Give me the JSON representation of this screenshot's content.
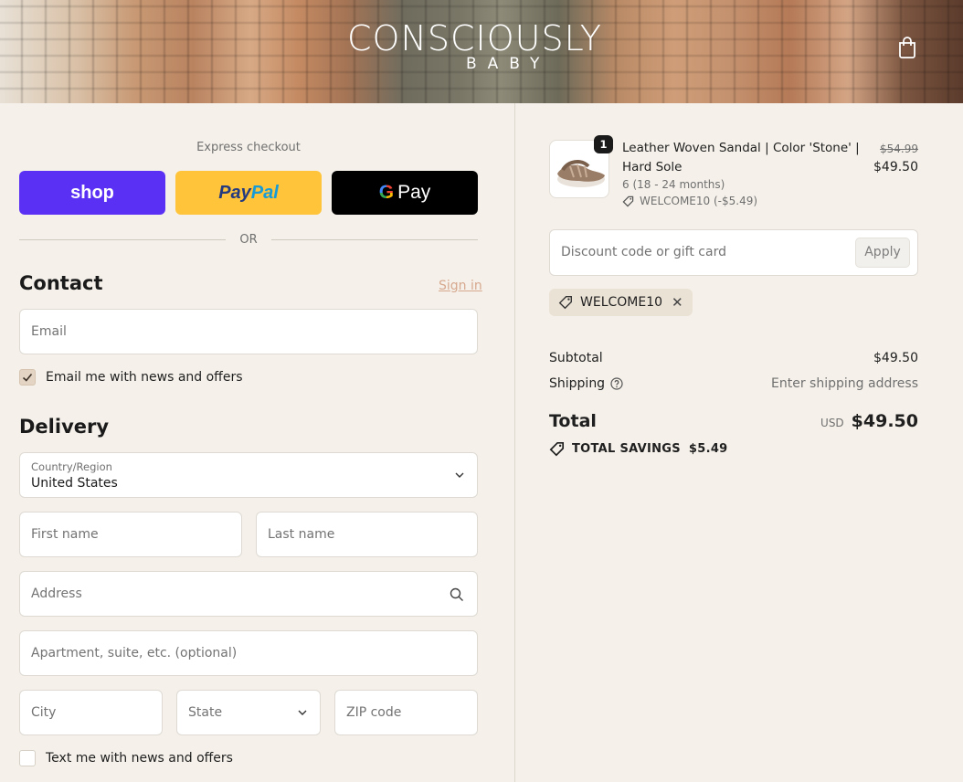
{
  "header": {
    "logo_main": "CONSCIOUSLY",
    "logo_sub": "BABY",
    "cart_icon": "shopping-bag-icon"
  },
  "express": {
    "title": "Express checkout",
    "shop_label": "shop",
    "paypal_a": "Pay",
    "paypal_b": "Pal",
    "gpay_g": "G",
    "gpay_label": "Pay",
    "or_label": "OR"
  },
  "contact": {
    "title": "Contact",
    "signin_label": "Sign in",
    "email_placeholder": "Email",
    "news_label": "Email me with news and offers",
    "news_checked": true
  },
  "delivery": {
    "title": "Delivery",
    "country_label": "Country/Region",
    "country_value": "United States",
    "first_name_placeholder": "First name",
    "last_name_placeholder": "Last name",
    "address_placeholder": "Address",
    "apartment_placeholder": "Apartment, suite, etc. (optional)",
    "city_placeholder": "City",
    "state_placeholder": "State",
    "zip_placeholder": "ZIP code",
    "text_label": "Text me with news and offers",
    "text_checked": false
  },
  "order": {
    "item": {
      "quantity": "1",
      "name": "Leather Woven Sandal | Color 'Stone' | Hard Sole",
      "variant": "6 (18 - 24 months)",
      "discount": "WELCOME10 (-$5.49)",
      "old_price": "$54.99",
      "price": "$49.50"
    },
    "discount_placeholder": "Discount code or gift card",
    "apply_label": "Apply",
    "applied_code": "WELCOME10",
    "subtotal_label": "Subtotal",
    "subtotal_value": "$49.50",
    "shipping_label": "Shipping",
    "shipping_value": "Enter shipping address",
    "total_label": "Total",
    "currency": "USD",
    "total_value": "$49.50",
    "savings_label": "TOTAL SAVINGS",
    "savings_value": "$5.49"
  }
}
